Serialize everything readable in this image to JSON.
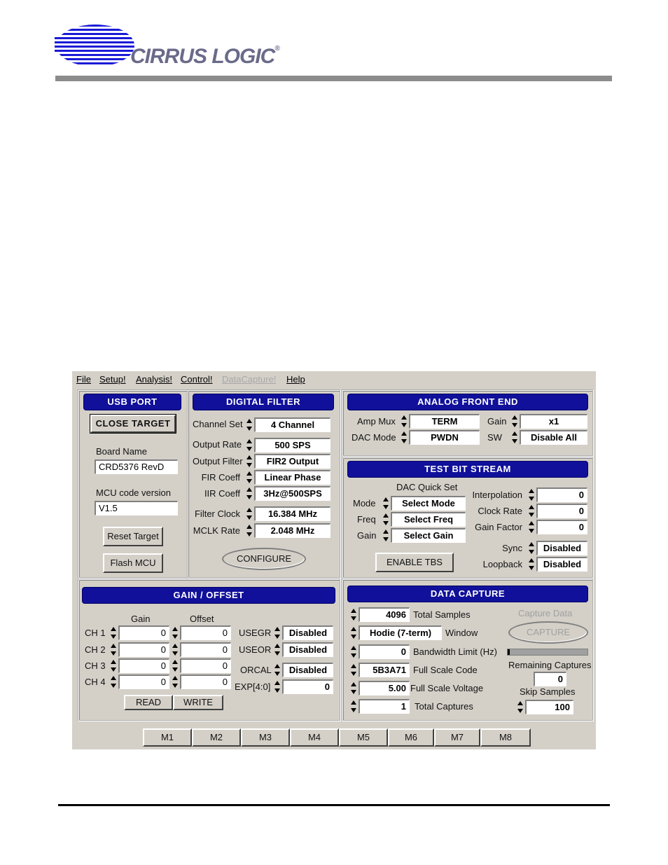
{
  "header": {
    "company": "CIRRUS LOGIC",
    "registered": "®"
  },
  "menu": [
    "File",
    "Setup!",
    "Analysis!",
    "Control!",
    "DataCapture!",
    "Help"
  ],
  "usb_port": {
    "title": "USB PORT",
    "close_target": "CLOSE TARGET",
    "board_name_label": "Board Name",
    "board_name": "CRD5376 RevD",
    "mcu_label": "MCU code version",
    "mcu_version": "V1.5",
    "reset_target": "Reset Target",
    "flash_mcu": "Flash MCU"
  },
  "digital_filter": {
    "title": "DIGITAL FILTER",
    "rows": [
      {
        "label": "Channel Set",
        "value": "4 Channel"
      },
      {
        "label": "Output Rate",
        "value": "500 SPS"
      },
      {
        "label": "Output Filter",
        "value": "FIR2 Output"
      },
      {
        "label": "FIR Coeff",
        "value": "Linear Phase"
      },
      {
        "label": "IIR Coeff",
        "value": "3Hz@500SPS"
      },
      {
        "label": "Filter Clock",
        "value": "16.384 MHz"
      },
      {
        "label": "MCLK Rate",
        "value": "2.048 MHz"
      }
    ],
    "configure": "CONFIGURE"
  },
  "analog_front_end": {
    "title": "ANALOG FRONT END",
    "amp_mux_label": "Amp Mux",
    "amp_mux": "TERM",
    "dac_mode_label": "DAC Mode",
    "dac_mode": "PWDN",
    "gain_label": "Gain",
    "gain": "x1",
    "sw_label": "SW",
    "sw": "Disable All"
  },
  "test_bit_stream": {
    "title": "TEST BIT STREAM",
    "dac_quick_set": "DAC Quick Set",
    "mode_label": "Mode",
    "mode": "Select Mode",
    "freq_label": "Freq",
    "freq": "Select Freq",
    "gain_label": "Gain",
    "gain": "Select Gain",
    "interpolation_label": "Interpolation",
    "interpolation": "0",
    "clock_rate_label": "Clock Rate",
    "clock_rate": "0",
    "gain_factor_label": "Gain Factor",
    "gain_factor": "0",
    "sync_label": "Sync",
    "sync": "Disabled",
    "loopback_label": "Loopback",
    "loopback": "Disabled",
    "enable_tbs": "ENABLE TBS"
  },
  "gain_offset": {
    "title": "GAIN / OFFSET",
    "gain_header": "Gain",
    "offset_header": "Offset",
    "channels": [
      {
        "label": "CH 1",
        "gain": "0",
        "offset": "0"
      },
      {
        "label": "CH 2",
        "gain": "0",
        "offset": "0"
      },
      {
        "label": "CH 3",
        "gain": "0",
        "offset": "0"
      },
      {
        "label": "CH 4",
        "gain": "0",
        "offset": "0"
      }
    ],
    "usegr_label": "USEGR",
    "usegr": "Disabled",
    "useor_label": "USEOR",
    "useor": "Disabled",
    "orcal_label": "ORCAL",
    "orcal": "Disabled",
    "exp_label": "EXP[4:0]",
    "exp": "0",
    "read": "READ",
    "write": "WRITE"
  },
  "data_capture": {
    "title": "DATA CAPTURE",
    "total_samples": "4096",
    "total_samples_label": "Total Samples",
    "window": "Hodie (7-term)",
    "window_label": "Window",
    "bandwidth": "0",
    "bandwidth_label": "Bandwidth Limit (Hz)",
    "full_scale_code": "5B3A71",
    "full_scale_code_label": "Full Scale Code",
    "full_scale_voltage": "5.00",
    "full_scale_voltage_label": "Full Scale Voltage",
    "total_captures": "1",
    "total_captures_label": "Total Captures",
    "capture_data_label": "Capture Data",
    "capture_button": "CAPTURE",
    "capture_progress": 0.03,
    "remaining_label": "Remaining Captures",
    "remaining": "0",
    "skip_label": "Skip Samples",
    "skip": "100"
  },
  "macros": [
    "M1",
    "M2",
    "M3",
    "M4",
    "M5",
    "M6",
    "M7",
    "M8"
  ]
}
